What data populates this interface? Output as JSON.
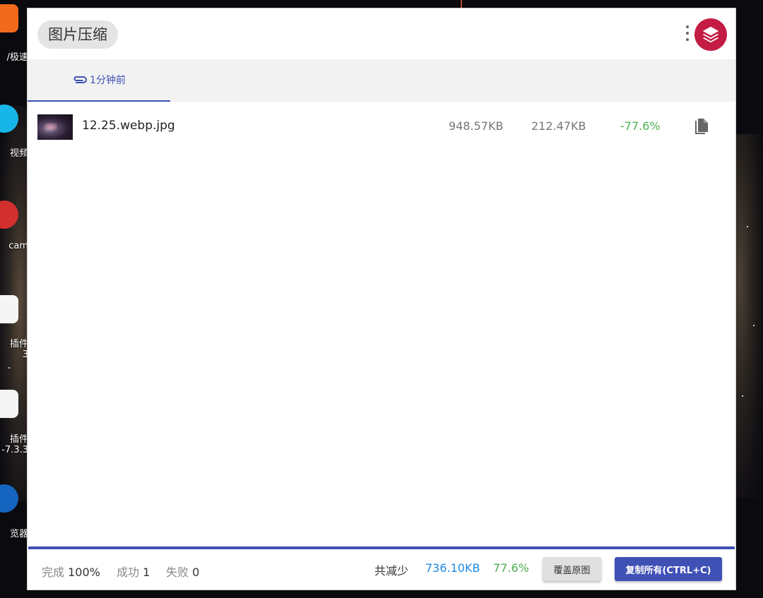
{
  "app": {
    "title": "图片压缩"
  },
  "tabs": [
    {
      "label": "1分钟前"
    }
  ],
  "files": [
    {
      "name": "12.25.webp.jpg",
      "original_size": "948.57KB",
      "compressed_size": "212.47KB",
      "change": "-77.6%"
    }
  ],
  "footer": {
    "done_label": "完成",
    "done_value": "100%",
    "success_label": "成功",
    "success_value": "1",
    "fail_label": "失败",
    "fail_value": "0",
    "reduced_label": "共减少",
    "reduced_kb": "736.10KB",
    "reduced_pct": "77.6%",
    "overwrite_button": "覆盖原图",
    "copy_all_button": "复制所有(CTRL+C)"
  },
  "desktop": {
    "labels": [
      "/极速",
      "视频",
      "cam",
      "插件",
      "3",
      "插件",
      "-7.3.3",
      "览器"
    ]
  },
  "colors": {
    "accent": "#3f51b5",
    "logo": "#c41c44",
    "success": "#4caf50",
    "link": "#1e88e5"
  },
  "icons": {
    "tab": "paperclip-icon",
    "file_action": "copy-icon",
    "menu": "more-vertical-icon",
    "logo": "layers-icon"
  }
}
